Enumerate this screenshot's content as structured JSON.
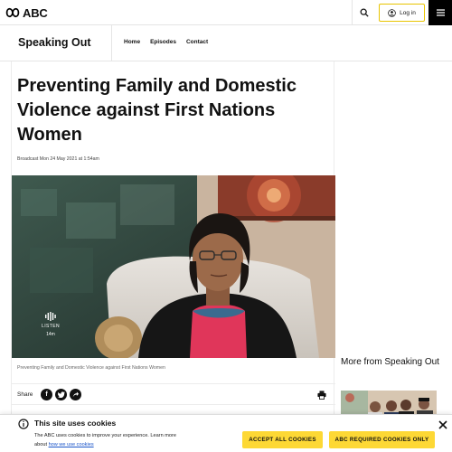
{
  "site": {
    "logo_text": "ABC"
  },
  "topbar": {
    "login_label": "Log in",
    "search_icon": "search-icon",
    "menu_icon": "hamburger-icon"
  },
  "program": {
    "title": "Speaking Out",
    "nav": [
      {
        "label": "Home"
      },
      {
        "label": "Episodes"
      },
      {
        "label": "Contact"
      }
    ]
  },
  "article": {
    "headline": "Preventing Family and Domestic Violence against First Nations Women",
    "broadcast": "Broadcast Mon 24 May 2021 at 1:54am",
    "caption": "Preventing Family and Domestic Violence against First Nations Women",
    "listen_label": "LISTEN",
    "duration": "14m",
    "share_label": "Share",
    "share_icons": [
      "facebook-icon",
      "twitter-icon",
      "share-icon"
    ],
    "print_icon": "print-icon"
  },
  "sidebar": {
    "more_title": "More from Speaking Out"
  },
  "cookie": {
    "title": "This site uses cookies",
    "text": "The ABC uses cookies to improve your experience. Learn more about",
    "link": "how we use cookies",
    "accept_label": "ACCEPT ALL COOKIES",
    "required_label": "ABC REQUIRED COOKIES ONLY"
  },
  "colors": {
    "accent_yellow": "#fdd835",
    "brand_black": "#000000",
    "link_blue": "#1a55c9"
  }
}
